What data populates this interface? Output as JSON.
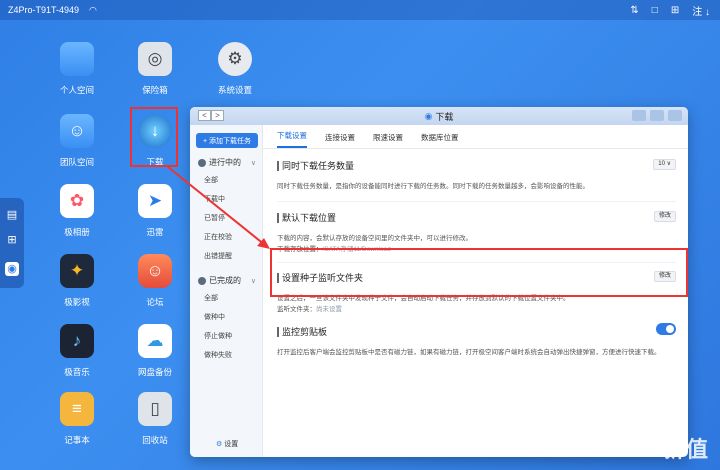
{
  "topbar": {
    "title": "Z4Pro-T91T-4949",
    "user": "注 ↓"
  },
  "apps": [
    {
      "label": "个人空间",
      "icon": "folder"
    },
    {
      "label": "保险箱",
      "icon": "safe"
    },
    {
      "label": "系统设置",
      "icon": "settings"
    },
    {
      "label": "团队空间",
      "icon": "team-folder"
    },
    {
      "label": "下载",
      "icon": "download"
    },
    {
      "label": "极相册",
      "icon": "photos"
    },
    {
      "label": "迅雷",
      "icon": "thunder"
    },
    {
      "label": "极影视",
      "icon": "video"
    },
    {
      "label": "论坛",
      "icon": "forum"
    },
    {
      "label": "极音乐",
      "icon": "music"
    },
    {
      "label": "网盘备份",
      "icon": "backup"
    },
    {
      "label": "记事本",
      "icon": "notes"
    },
    {
      "label": "回收站",
      "icon": "trash"
    }
  ],
  "window": {
    "title": "下载",
    "add_task": "+ 添加下载任务",
    "group_running": "进行中的",
    "running_items": [
      "全部",
      "下载中",
      "已暂停",
      "正在校验",
      "出错提醒"
    ],
    "group_done": "已完成的",
    "done_items": [
      "全部",
      "做种中",
      "停止做种",
      "做种失败"
    ],
    "settings": "设置",
    "tabs": [
      "下载设置",
      "连接设置",
      "限速设置",
      "数据库位置"
    ],
    "sec1": {
      "title": "同时下载任务数量",
      "desc": "同时下载任务数量，是指你的设备能同时进行下载的任务数。同时下载的任务数量越多，会影响设备的性能。",
      "value": "10"
    },
    "sec2": {
      "title": "默认下载位置",
      "desc": "下载的内容，会默认存放的设备空间里的文件夹中，可以进行修改。",
      "path_label": "下载存放位置：",
      "path": "/SATA存储11/Download",
      "edit": "修改"
    },
    "sec3": {
      "title": "设置种子监听文件夹",
      "desc": "设置之后，一旦该文件夹中发现种子文件，会自动启动下载任务，并存放到默认的下载位置文件夹中。",
      "folder_label": "监听文件夹：",
      "folder": "尚未设置",
      "edit": "修改"
    },
    "sec4": {
      "title": "监控剪贴板",
      "desc": "打开监控后客户端会监控剪贴板中是否有磁力链，如果有磁力链，打开极空间客户端时系统会自动弹出快捷弹窗，方便进行快速下载。",
      "enabled": true
    }
  },
  "watermark": "新值"
}
